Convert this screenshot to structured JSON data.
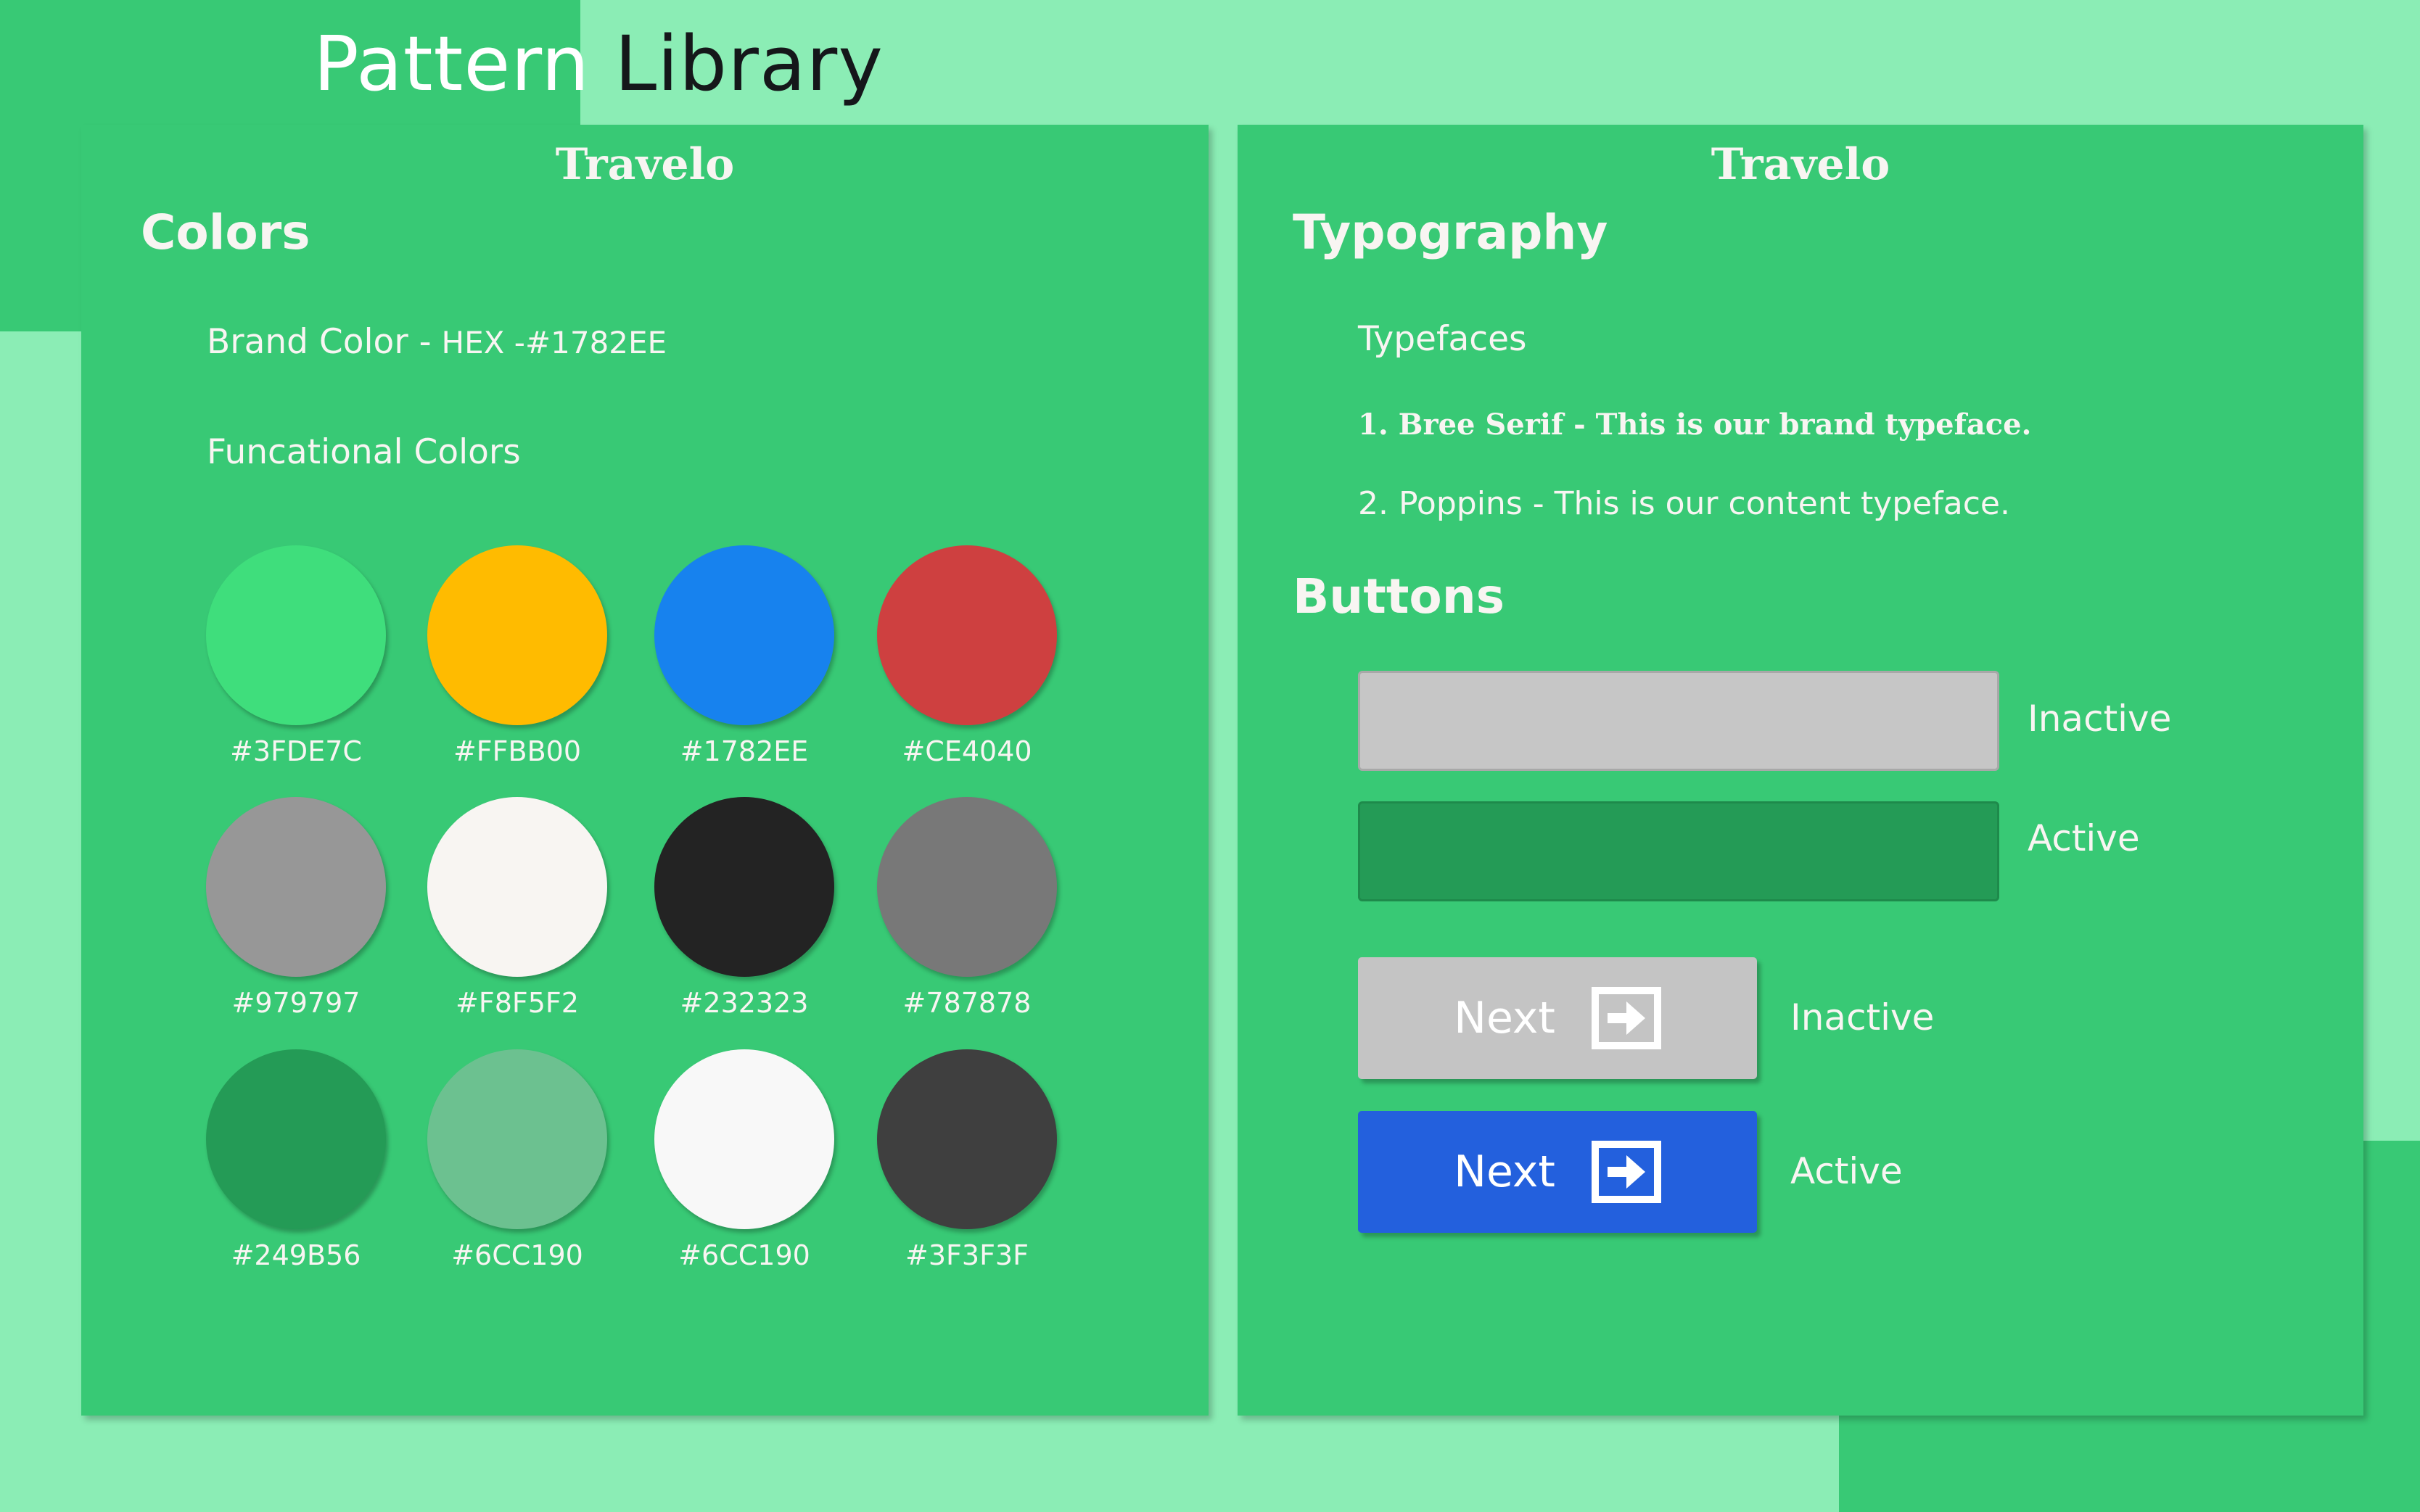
{
  "page": {
    "title_part1": "Pattern",
    "title_part2": "Library"
  },
  "colors_panel": {
    "brand_name": "Travelo",
    "section_title": "Colors",
    "brand_color_label": "Brand Color -",
    "brand_color_value": "HEX -#1782EE",
    "functional_colors_label": "Funcational Colors",
    "swatches": [
      {
        "hex": "#3FDE7C",
        "label": "#3FDE7C"
      },
      {
        "hex": "#FFBB00",
        "label": "#FFBB00"
      },
      {
        "hex": "#1782EE",
        "label": "#1782EE"
      },
      {
        "hex": "#CE4040",
        "label": "#CE4040"
      },
      {
        "hex": "#979797",
        "label": "#979797"
      },
      {
        "hex": "#F8F5F2",
        "label": "#F8F5F2"
      },
      {
        "hex": "#232323",
        "label": "#232323"
      },
      {
        "hex": "#787878",
        "label": "#787878"
      },
      {
        "hex": "#249B56",
        "label": "#249B56"
      },
      {
        "hex": "#6CC190",
        "label": "#6CC190"
      },
      {
        "hex": "#F8F8F8",
        "label": "#6CC190"
      },
      {
        "hex": "#3F3F3F",
        "label": "#3F3F3F"
      }
    ]
  },
  "typography_panel": {
    "brand_name": "Travelo",
    "section_title": "Typography",
    "typefaces_label": "Typefaces",
    "typeface_1": "1. Bree Serif - This is our brand typeface.",
    "typeface_2": "2. Poppins - This is our content typeface.",
    "buttons_title": "Buttons",
    "bar_inactive_label": "Inactive",
    "bar_active_label": "Active",
    "next_inactive": {
      "label": "Next",
      "state": "Inactive",
      "icon": "arrow-right-box-icon"
    },
    "next_active": {
      "label": "Next",
      "state": "Active",
      "icon": "arrow-right-box-icon"
    }
  },
  "colors": {
    "background": "#8BEDB5",
    "panel": "#38C975",
    "button_inactive": "#C4C4C4",
    "button_active": "#2360DD",
    "bar_active": "#249B56"
  }
}
